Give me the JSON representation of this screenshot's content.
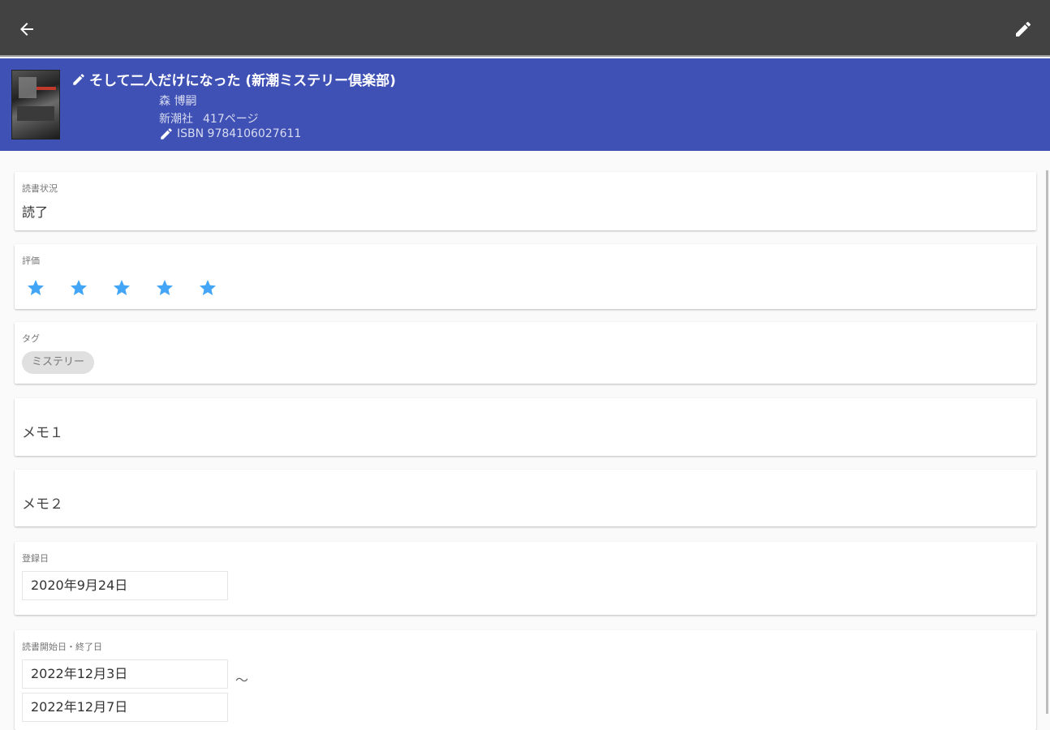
{
  "appbar": {
    "back_icon": "arrow-back-icon",
    "edit_icon": "pencil-icon"
  },
  "book": {
    "title": "そして二人だけになった (新潮ミステリー倶楽部)",
    "author": "森 博嗣",
    "publisher": "新潮社",
    "pages": "417ページ",
    "isbn": "ISBN 9784106027611"
  },
  "reading_status": {
    "label": "読書状況",
    "value": "読了"
  },
  "rating": {
    "label": "評価",
    "value": 5,
    "max": 5,
    "color": "#42a5f5"
  },
  "tags": {
    "label": "タグ",
    "items": [
      "ミステリー"
    ]
  },
  "memo1": {
    "label": "メモ１"
  },
  "memo2": {
    "label": "メモ２"
  },
  "registered": {
    "label": "登録日",
    "date": "2020年9月24日"
  },
  "reading_period": {
    "label": "読書開始日・終了日",
    "start": "2022年12月3日",
    "separator": "〜",
    "end": "2022年12月7日"
  },
  "colors": {
    "appbar": "#424242",
    "header": "#3f51b5",
    "star": "#42a5f5"
  }
}
